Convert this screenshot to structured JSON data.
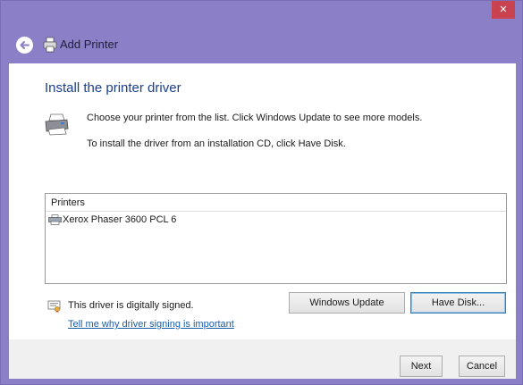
{
  "window": {
    "title": "Add Printer",
    "close_label": "✕",
    "accent_color": "#8b7fc7",
    "close_color": "#c8424f"
  },
  "icons": {
    "back": "back-arrow-icon",
    "title_printer": "printer-icon",
    "main_printer": "printer-icon",
    "list_printer": "printer-icon",
    "signature": "signed-driver-icon"
  },
  "main": {
    "heading": "Install the printer driver",
    "description_1": "Choose your printer from the list. Click Windows Update to see more models.",
    "description_2": "To install the driver from an installation CD, click Have Disk."
  },
  "printers_list": {
    "header": "Printers",
    "items": [
      {
        "label": "Xerox Phaser 3600 PCL 6",
        "selected": false
      }
    ]
  },
  "signature": {
    "text": "This driver is digitally signed.",
    "link": "Tell me why driver signing is important"
  },
  "buttons": {
    "windows_update": "Windows Update",
    "have_disk": "Have Disk...",
    "next": "Next",
    "cancel": "Cancel"
  }
}
